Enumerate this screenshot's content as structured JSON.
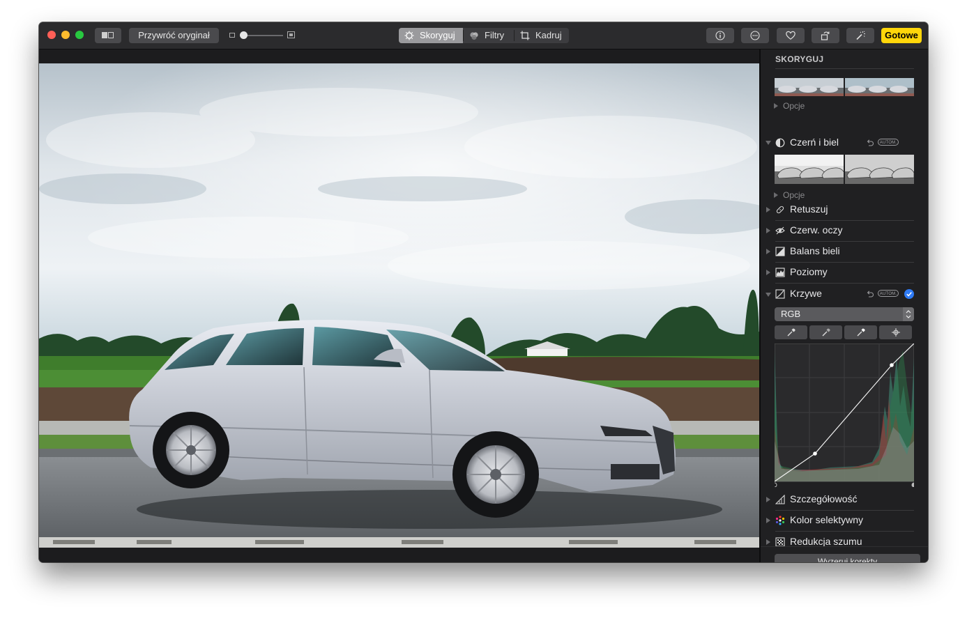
{
  "toolbar": {
    "revert_label": "Przywróć oryginał",
    "tabs": [
      {
        "label": "Skoryguj",
        "icon": "adjust-icon",
        "active": true
      },
      {
        "label": "Filtry",
        "icon": "filters-icon",
        "active": false
      },
      {
        "label": "Kadruj",
        "icon": "crop-icon",
        "active": false
      }
    ],
    "right_buttons": [
      "info-icon",
      "more-icon",
      "heart-icon",
      "rotate-icon",
      "magic-wand-icon"
    ],
    "done_label": "Gotowe",
    "colors": {
      "done": "#ffd60a",
      "close": "#ff5f57",
      "minimize": "#febc2e",
      "maximize": "#28c840"
    }
  },
  "sidebar": {
    "title": "SKORYGUJ",
    "options_label": "Opcje",
    "bw_label": "Czerń i biel",
    "auto_label": "AUTOM.",
    "sections": [
      {
        "label": "Retuszuj",
        "icon": "bandage-icon"
      },
      {
        "label": "Czerw. oczy",
        "icon": "red-eye-icon"
      },
      {
        "label": "Balans bieli",
        "icon": "white-balance-icon"
      },
      {
        "label": "Poziomy",
        "icon": "levels-icon"
      }
    ],
    "curves_label": "Krzywe",
    "channel": "RGB",
    "bottom_sections": [
      {
        "label": "Szczegółowość",
        "icon": "definition-icon"
      },
      {
        "label": "Kolor selektywny",
        "icon": "selective-color-icon"
      },
      {
        "label": "Redukcja szumu",
        "icon": "noise-reduction-icon"
      }
    ],
    "reset_label": "Wyzeruj korekty",
    "accent_color": "#2f7bf5"
  }
}
